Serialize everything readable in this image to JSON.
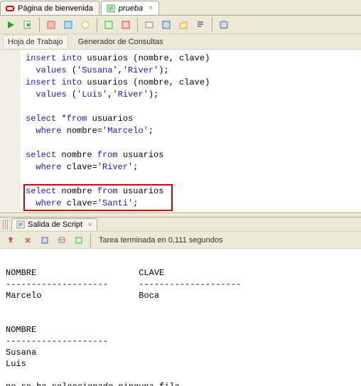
{
  "tabs": {
    "welcome": "Página de bienvenida",
    "prueba": "prueba"
  },
  "subtabs": {
    "worksheet": "Hoja de Trabajo",
    "querybuilder": "Generador de Consultas"
  },
  "code_lines": [
    {
      "text_html": "<span class='kw'>insert</span> <span class='kw'>into</span> usuarios (nombre, clave)"
    },
    {
      "text_html": "  <span class='kw'>values</span> (<span class='str'>'Susana'</span>,<span class='str'>'River'</span>);"
    },
    {
      "text_html": "<span class='kw'>insert</span> <span class='kw'>into</span> usuarios (nombre, clave)"
    },
    {
      "text_html": "  <span class='kw'>values</span> (<span class='str'>'Luis'</span>,<span class='str'>'River'</span>);"
    },
    {
      "text_html": ""
    },
    {
      "text_html": "<span class='kw'>select</span> *<span class='kw'>from</span> usuarios"
    },
    {
      "text_html": "  <span class='kw'>where</span> nombre=<span class='str'>'Marcelo'</span>;"
    },
    {
      "text_html": ""
    },
    {
      "text_html": "<span class='kw'>select</span> nombre <span class='kw'>from</span> usuarios"
    },
    {
      "text_html": "  <span class='kw'>where</span> clave=<span class='str'>'River'</span>;"
    },
    {
      "text_html": ""
    },
    {
      "text_html": "<span class='kw'>select</span> nombre <span class='kw'>from</span> usuarios"
    },
    {
      "text_html": "  <span class='kw'>where</span> clave=<span class='str'>'Santi'</span>;"
    }
  ],
  "output_panel": {
    "tab_label": "Salida de Script",
    "status": "Tarea terminada en 0,111 segundos",
    "text": "\nNOMBRE                    CLAVE\n--------------------      --------------------\nMarcelo                   Boca\n\n\nNOMBRE\n--------------------\nSusana\nLuis\n\nno se ha seleccionado ninguna fila\n"
  },
  "toolbar_icons": [
    "run",
    "run-script",
    "new",
    "open",
    "save",
    "save-all",
    "undo",
    "redo",
    "cut",
    "copy",
    "paste",
    "find",
    "explain-plan",
    "autotrace",
    "sql-tune",
    "commit",
    "rollback"
  ]
}
